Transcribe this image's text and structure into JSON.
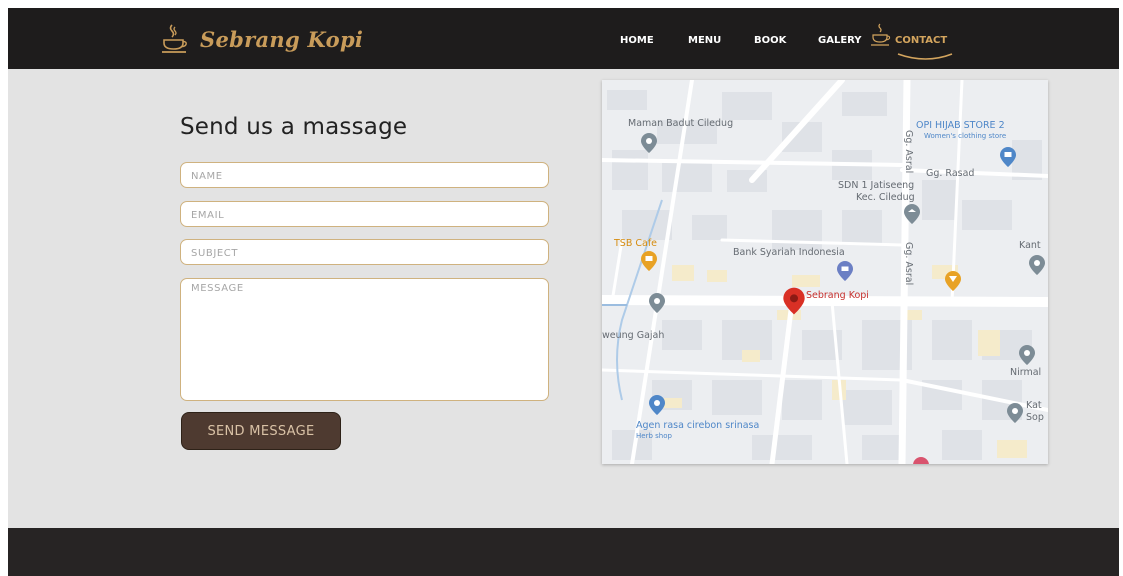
{
  "brand": {
    "name": "Sebrang Kopi"
  },
  "nav": {
    "items": [
      {
        "label": "HOME"
      },
      {
        "label": "MENU"
      },
      {
        "label": "BOOK"
      },
      {
        "label": "GALERY"
      },
      {
        "label": "CONTACT",
        "active": true
      }
    ]
  },
  "contact_form": {
    "title": "Send us a massage",
    "name_placeholder": "NAME",
    "email_placeholder": "EMAIL",
    "subject_placeholder": "SUBJECT",
    "message_placeholder": "MESSAGE",
    "send_label": "SEND MESSAGE"
  },
  "map": {
    "labels": {
      "maman_badut": "Maman Badut Ciledug",
      "opi_hijab": "OPI HIJAB STORE 2",
      "opi_hijab_sub": "Women's clothing store",
      "gg_rasad": "Gg. Rasad",
      "gg_asral_1": "Gg. Asral",
      "gg_asral_2": "Gg. Asral",
      "sdn_1": "SDN 1 Jatiseeng",
      "sdn_2": "Kec. Ciledug",
      "tsb_cafe": "TSB Cafe",
      "bank_syariah": "Bank Syariah Indonesia",
      "kant": "Kant",
      "sebrang_kopi": "Sebrang Kopi",
      "weung_gajah": "weung Gajah",
      "nirmal": "Nirmal",
      "kat": "Kat",
      "sop": "Sop",
      "agen": "Agen rasa cirebon srinasa",
      "agen_sub": "Herb shop"
    }
  },
  "colors": {
    "navbar": "#1e1c1c",
    "accent_gold": "#c99c5a",
    "page_bg": "#e3e3e3",
    "button": "#4e3a30",
    "footer": "#272424",
    "map_pin_red": "#d93025",
    "map_pin_blue": "#4f87c8",
    "map_pin_orange": "#e8a225",
    "map_pin_grey": "#7d8c96"
  },
  "icons": {
    "brand": "coffee-cup-icon",
    "nav_active": "coffee-cup-icon",
    "map_primary": "map-pin-icon"
  }
}
